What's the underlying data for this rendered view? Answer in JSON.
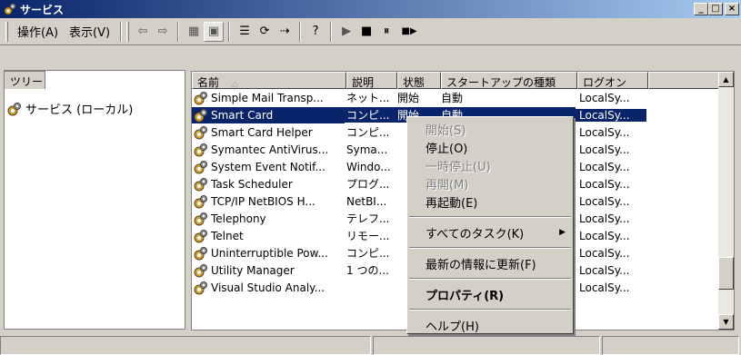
{
  "window": {
    "title": "サービス",
    "minimize": "_",
    "maximize": "□",
    "close": "×"
  },
  "menubar": {
    "action": "操作(A)",
    "view": "表示(V)"
  },
  "toolbar": {
    "back": "⇦",
    "forward": "⇨",
    "up": "▦",
    "show_tree": "▣",
    "properties": "☰",
    "refresh": "⟳",
    "export": "⇢",
    "help": "?",
    "start": "▶",
    "stop": "■",
    "pause": "⏸",
    "restart": "■▶"
  },
  "tree": {
    "tab_label": "ツリー",
    "root_label": "サービス (ローカル)"
  },
  "list": {
    "headers": {
      "name": "名前",
      "name_sort": "△",
      "desc": "説明",
      "status": "状態",
      "startup": "スタートアップの種類",
      "logon": "ログオン"
    },
    "rows": [
      {
        "name": "Simple Mail Transp...",
        "desc": "ネット...",
        "status": "開始",
        "startup": "自動",
        "logon": "LocalSy..."
      },
      {
        "name": "Smart Card",
        "desc": "コンピ...",
        "status": "開始",
        "startup": "自動",
        "logon": "LocalSy..."
      },
      {
        "name": "Smart Card Helper",
        "desc": "コンピ...",
        "status": "",
        "startup": "",
        "logon": "LocalSy..."
      },
      {
        "name": "Symantec AntiVirus...",
        "desc": "Syma...",
        "status": "",
        "startup": "",
        "logon": "LocalSy..."
      },
      {
        "name": "System Event Notif...",
        "desc": "Windo...",
        "status": "",
        "startup": "",
        "logon": "LocalSy..."
      },
      {
        "name": "Task Scheduler",
        "desc": "プログ...",
        "status": "",
        "startup": "",
        "logon": "LocalSy..."
      },
      {
        "name": "TCP/IP NetBIOS H...",
        "desc": "NetBI...",
        "status": "",
        "startup": "",
        "logon": "LocalSy..."
      },
      {
        "name": "Telephony",
        "desc": "テレフ...",
        "status": "",
        "startup": "",
        "logon": "LocalSy..."
      },
      {
        "name": "Telnet",
        "desc": "リモー...",
        "status": "",
        "startup": "",
        "logon": "LocalSy..."
      },
      {
        "name": "Uninterruptible Pow...",
        "desc": "コンピ...",
        "status": "",
        "startup": "",
        "logon": "LocalSy..."
      },
      {
        "name": "Utility Manager",
        "desc": "1 つの...",
        "status": "",
        "startup": "",
        "logon": "LocalSy..."
      },
      {
        "name": "Visual Studio Analy...",
        "desc": "",
        "status": "",
        "startup": "",
        "logon": "LocalSy..."
      }
    ],
    "selected_index": 1
  },
  "context_menu": {
    "start": "開始(S)",
    "stop": "停止(O)",
    "pause": "一時停止(U)",
    "resume": "再開(M)",
    "restart": "再起動(E)",
    "all_tasks": "すべてのタスク(K)",
    "refresh": "最新の情報に更新(F)",
    "properties": "プロパティ(R)",
    "help": "ヘルプ(H)"
  },
  "colors": {
    "selection": "#0a246a",
    "title_start": "#0a246a",
    "title_end": "#a6caf0",
    "chrome": "#d4d0c8"
  }
}
